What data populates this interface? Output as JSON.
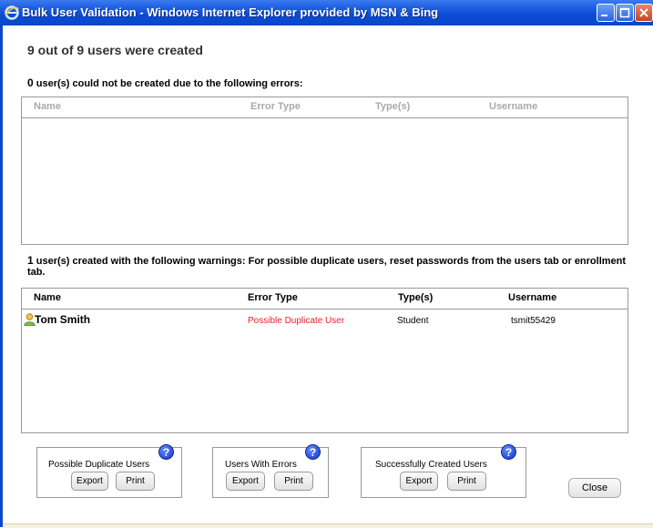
{
  "window": {
    "title": "Bulk User Validation - Windows Internet Explorer provided by MSN & Bing",
    "icon": "ie-icon"
  },
  "headline": "9 out of 9 users were created",
  "errors_section": {
    "count": "0",
    "text": " user(s) could not be created due to the following errors:",
    "columns": [
      "Name",
      "Error Type",
      "Type(s)",
      "Username"
    ],
    "rows": []
  },
  "warnings_section": {
    "count": "1",
    "text": " user(s) created with the following warnings: For possible duplicate users, reset passwords from the users tab or enrollment tab.",
    "columns": [
      "Name",
      "Error Type",
      "Type(s)",
      "Username"
    ],
    "rows": [
      {
        "name": "Tom Smith",
        "error_type": "Possible Duplicate User",
        "type": "Student",
        "username": "tsmit55429"
      }
    ]
  },
  "groups": [
    {
      "label": "Possible Duplicate Users",
      "export": "Export",
      "print": "Print"
    },
    {
      "label": "Users With Errors",
      "export": "Export",
      "print": "Print"
    },
    {
      "label": "Successfully Created Users",
      "export": "Export",
      "print": "Print"
    }
  ],
  "close_label": "Close",
  "help_glyph": "?",
  "colors": {
    "error_text": "#e8202a",
    "titlebar": "#0b47c8"
  }
}
